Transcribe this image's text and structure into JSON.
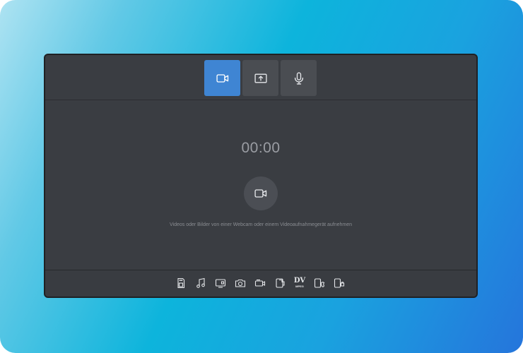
{
  "modes": [
    {
      "id": "video",
      "icon": "video-camera-icon",
      "active": true
    },
    {
      "id": "screen",
      "icon": "screen-share-icon",
      "active": false
    },
    {
      "id": "audio",
      "icon": "microphone-icon",
      "active": false
    }
  ],
  "main": {
    "timer": "00:00",
    "record_icon": "video-camera-icon",
    "hint": "Videos oder Bilder von einer Webcam oder einem Videoaufnahmegerät aufnehmen"
  },
  "formats": {
    "icons": [
      "sd-card-icon",
      "music-note-icon",
      "tv-player-icon",
      "camera-icon",
      "camcorder-icon",
      "phone-device-icon",
      "dv-icon",
      "apple-device-icon",
      "android-device-icon"
    ],
    "dv_big": "DV",
    "dv_small": "MPEG"
  },
  "colors": {
    "accent": "#3f85d3",
    "panel": "#3a3d42"
  }
}
